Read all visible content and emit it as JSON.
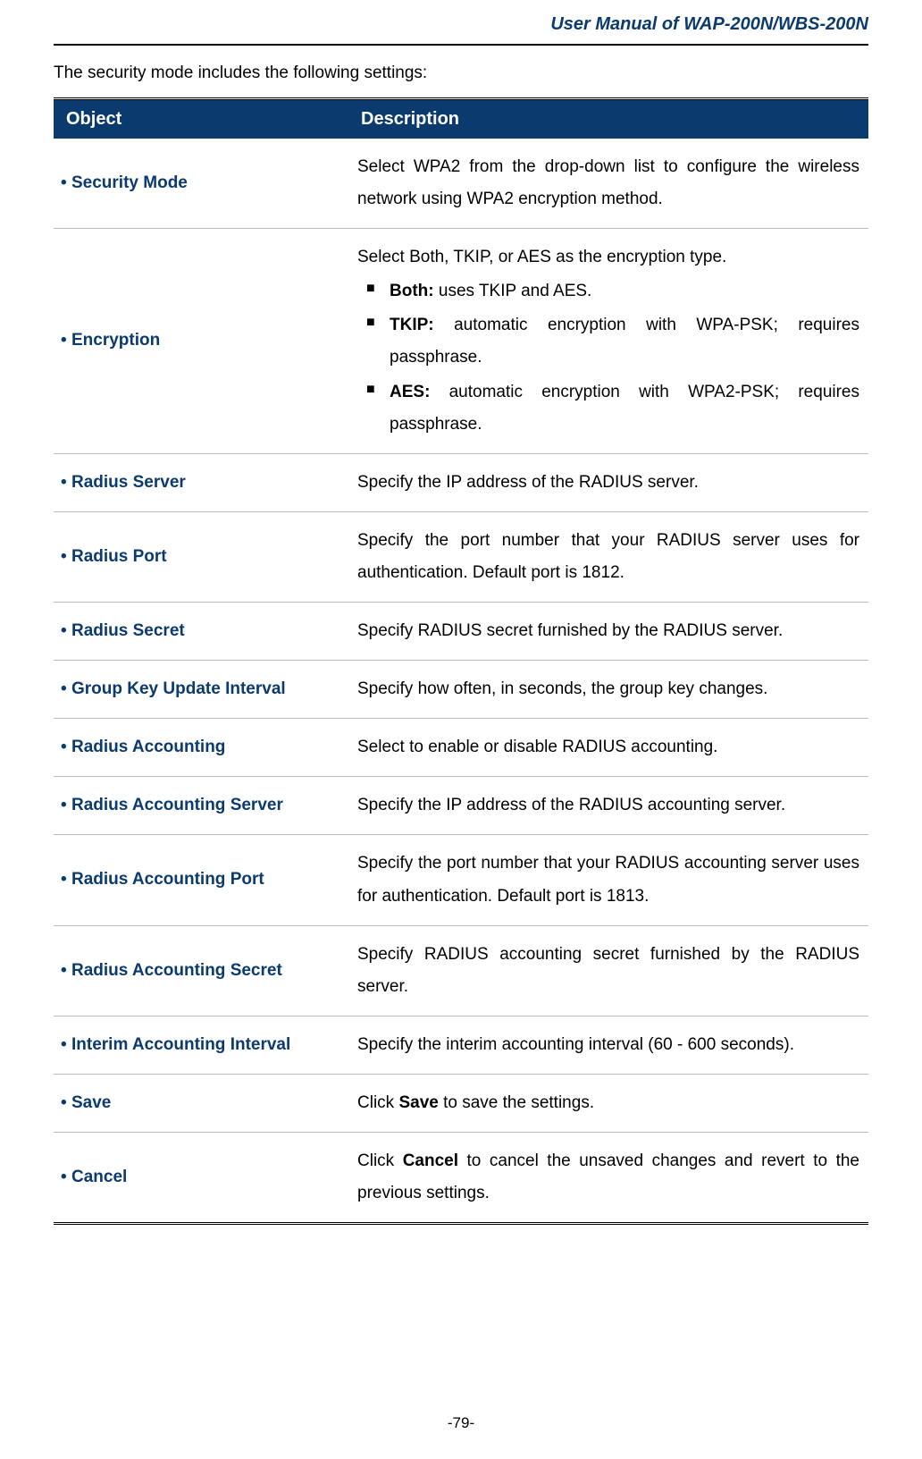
{
  "header": {
    "title": "User Manual of WAP-200N/WBS-200N"
  },
  "intro": "The security mode includes the following settings:",
  "table": {
    "columns": {
      "object": "Object",
      "description": "Description"
    },
    "rows": [
      {
        "object": "Security Mode",
        "description": "Select WPA2 from the drop-down list to configure the wireless network using WPA2 encryption method."
      },
      {
        "object": "Encryption",
        "description_intro": "Select Both, TKIP, or AES as the encryption type.",
        "items": [
          {
            "label": "Both:",
            "text": " uses TKIP and AES."
          },
          {
            "label": "TKIP:",
            "text": " automatic encryption with WPA-PSK; requires passphrase."
          },
          {
            "label": "AES:",
            "text": " automatic encryption with WPA2-PSK; requires passphrase."
          }
        ]
      },
      {
        "object": "Radius Server",
        "description": "Specify the IP address of the RADIUS server."
      },
      {
        "object": "Radius Port",
        "description": "Specify the port number that your RADIUS server uses for authentication. Default port is 1812."
      },
      {
        "object": "Radius Secret",
        "description": "Specify RADIUS secret furnished by the RADIUS server."
      },
      {
        "object": "Group Key Update Interval",
        "description": "Specify how often, in seconds, the group key changes."
      },
      {
        "object": "Radius Accounting",
        "description": "Select to enable or disable RADIUS accounting."
      },
      {
        "object": "Radius Accounting Server",
        "description": "Specify the IP address of the RADIUS accounting server."
      },
      {
        "object": "Radius Accounting Port",
        "description": "Specify the port number that your RADIUS accounting server uses for authentication. Default port is 1813."
      },
      {
        "object": "Radius Accounting Secret",
        "description": "Specify RADIUS accounting secret furnished by the RADIUS server."
      },
      {
        "object": "Interim Accounting Interval",
        "description": "Specify the interim accounting interval (60 - 600 seconds)."
      },
      {
        "object": "Save",
        "desc_prefix": "Click ",
        "desc_bold": "Save",
        "desc_suffix": " to save the settings."
      },
      {
        "object": "Cancel",
        "desc_prefix": "Click ",
        "desc_bold": "Cancel",
        "desc_suffix": " to cancel the unsaved changes and revert to the previous settings."
      }
    ]
  },
  "footer": {
    "page_number": "-79-"
  }
}
